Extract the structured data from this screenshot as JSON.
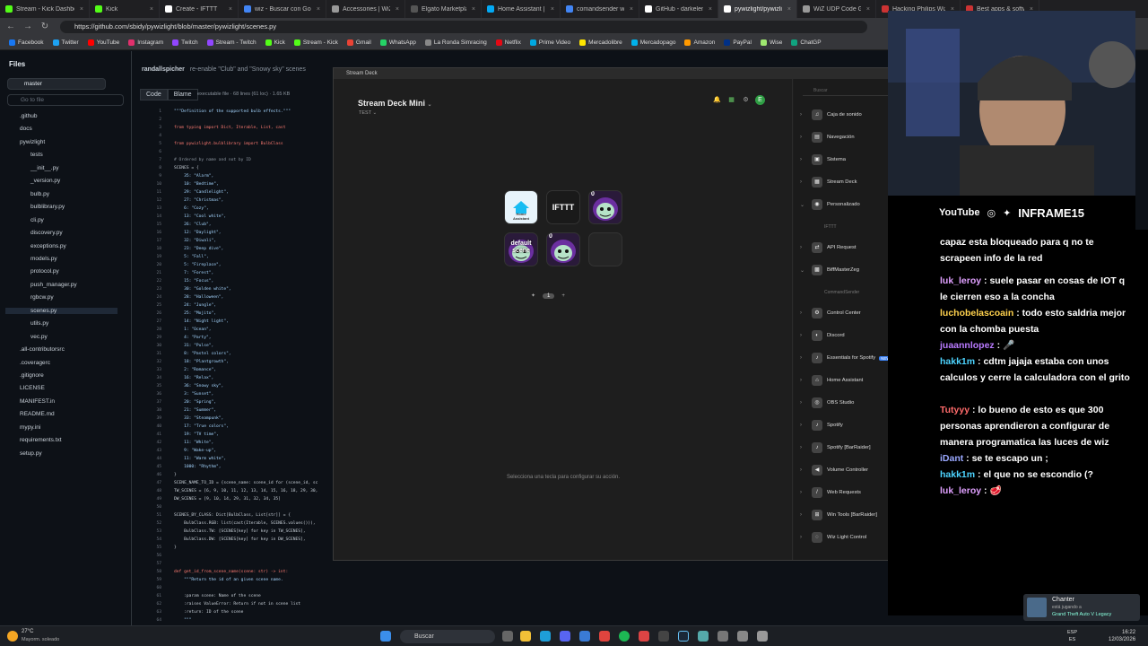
{
  "browser": {
    "tabs": [
      {
        "label": "Stream - Kick Dashbo",
        "color": "#53fc18"
      },
      {
        "label": "Kick",
        "color": "#53fc18"
      },
      {
        "label": "Create - IFTTT",
        "color": "#ffffff"
      },
      {
        "label": "wiz - Buscar con Goog",
        "color": "#4285f4"
      },
      {
        "label": "Accessories | WiZ AR",
        "color": "#999999"
      },
      {
        "label": "Elgato Marketplace",
        "color": "#555555"
      },
      {
        "label": "Home Assistant | Elga",
        "color": "#03a9f4"
      },
      {
        "label": "comandsender wiz - B",
        "color": "#4285f4"
      },
      {
        "label": "GitHub - darkelement",
        "color": "#ffffff"
      },
      {
        "label": "pywizlight/pywizlight",
        "color": "#ffffff"
      },
      {
        "label": "WiZ UDP Code Genera",
        "color": "#999999"
      },
      {
        "label": "Hacking Philips Wiz lig",
        "color": "#cc3333"
      },
      {
        "label": "Best apps & software",
        "color": "#cc3333"
      }
    ],
    "url": "https://github.com/sbidy/pywizlight/blob/master/pywizlight/scenes.py",
    "bookmarks": [
      {
        "label": "Facebook",
        "color": "#1877f2"
      },
      {
        "label": "Twitter",
        "color": "#1da1f2"
      },
      {
        "label": "YouTube",
        "color": "#ff0000"
      },
      {
        "label": "Instagram",
        "color": "#e1306c"
      },
      {
        "label": "Twitch",
        "color": "#9146ff"
      },
      {
        "label": "Stream - Twitch",
        "color": "#9146ff"
      },
      {
        "label": "Kick",
        "color": "#53fc18"
      },
      {
        "label": "Stream - Kick",
        "color": "#53fc18"
      },
      {
        "label": "Gmail",
        "color": "#ea4335"
      },
      {
        "label": "WhatsApp",
        "color": "#25d366"
      },
      {
        "label": "La Ronda Simracing",
        "color": "#888888"
      },
      {
        "label": "Netflix",
        "color": "#e50914"
      },
      {
        "label": "Prime Video",
        "color": "#00a8e1"
      },
      {
        "label": "Mercadolibre",
        "color": "#ffe600"
      },
      {
        "label": "Mercadopago",
        "color": "#00b1ea"
      },
      {
        "label": "Amazon",
        "color": "#ff9900"
      },
      {
        "label": "PayPal",
        "color": "#003087"
      },
      {
        "label": "Wise",
        "color": "#9fe870"
      },
      {
        "label": "ChatGP",
        "color": "#10a37f"
      }
    ]
  },
  "github": {
    "files_title": "Files",
    "branch": "master",
    "goto_placeholder": "Go to file",
    "tree": [
      {
        "label": ".github",
        "depth": 1
      },
      {
        "label": "docs",
        "depth": 1
      },
      {
        "label": "pywizlight",
        "depth": 1
      },
      {
        "label": "tests",
        "depth": 2
      },
      {
        "label": "__init__.py",
        "depth": 2
      },
      {
        "label": "_version.py",
        "depth": 2
      },
      {
        "label": "bulb.py",
        "depth": 2
      },
      {
        "label": "bulblibrary.py",
        "depth": 2
      },
      {
        "label": "cli.py",
        "depth": 2
      },
      {
        "label": "discovery.py",
        "depth": 2
      },
      {
        "label": "exceptions.py",
        "depth": 2
      },
      {
        "label": "models.py",
        "depth": 2
      },
      {
        "label": "protocol.py",
        "depth": 2
      },
      {
        "label": "push_manager.py",
        "depth": 2
      },
      {
        "label": "rgbcw.py",
        "depth": 2
      },
      {
        "label": "scenes.py",
        "depth": 2,
        "selected": true
      },
      {
        "label": "utils.py",
        "depth": 2
      },
      {
        "label": "vec.py",
        "depth": 2
      },
      {
        "label": ".all-contributorsrc",
        "depth": 1
      },
      {
        "label": ".coveragerc",
        "depth": 1
      },
      {
        "label": ".gitignore",
        "depth": 1
      },
      {
        "label": "LICENSE",
        "depth": 1
      },
      {
        "label": "MANIFEST.in",
        "depth": 1
      },
      {
        "label": "README.md",
        "depth": 1
      },
      {
        "label": "mypy.ini",
        "depth": 1
      },
      {
        "label": "requirements.txt",
        "depth": 1
      },
      {
        "label": "setup.py",
        "depth": 1
      }
    ],
    "commit_user": "randallspicher",
    "commit_msg": "re-enable \"Club\" and \"Snowy sky\" scenes",
    "code_tab": "Code",
    "blame_tab": "Blame",
    "file_info": "executable file · 68 lines (61 loc) · 1.65 KB",
    "code": [
      {
        "n": "1",
        "t": "\"\"\"Definition of the supported bulb effects.\"\"\""
      },
      {
        "n": "2",
        "t": ""
      },
      {
        "n": "3",
        "t": "from typing import Dict, Iterable, List, cast"
      },
      {
        "n": "4",
        "t": ""
      },
      {
        "n": "5",
        "t": "from pywizlight.bulblibrary import BulbClass"
      },
      {
        "n": "6",
        "t": ""
      },
      {
        "n": "7",
        "t": "# Ordered by name and not by ID"
      },
      {
        "n": "8",
        "t": "SCENES = {"
      },
      {
        "n": "9",
        "t": "    35: \"Alarm\","
      },
      {
        "n": "10",
        "t": "    10: \"Bedtime\","
      },
      {
        "n": "11",
        "t": "    29: \"Candlelight\","
      },
      {
        "n": "12",
        "t": "    27: \"Christmas\","
      },
      {
        "n": "13",
        "t": "    6: \"Cozy\","
      },
      {
        "n": "14",
        "t": "    13: \"Cool white\","
      },
      {
        "n": "15",
        "t": "    26: \"Club\","
      },
      {
        "n": "16",
        "t": "    12: \"Daylight\","
      },
      {
        "n": "17",
        "t": "    32: \"Diwali\","
      },
      {
        "n": "18",
        "t": "    23: \"Deep dive\","
      },
      {
        "n": "19",
        "t": "    5: \"Fall\","
      },
      {
        "n": "20",
        "t": "    5: \"Fireplace\","
      },
      {
        "n": "21",
        "t": "    7: \"Forest\","
      },
      {
        "n": "22",
        "t": "    15: \"Focus\","
      },
      {
        "n": "23",
        "t": "    30: \"Golden white\","
      },
      {
        "n": "24",
        "t": "    28: \"Halloween\","
      },
      {
        "n": "25",
        "t": "    24: \"Jungle\","
      },
      {
        "n": "26",
        "t": "    25: \"Mojito\","
      },
      {
        "n": "27",
        "t": "    14: \"Night light\","
      },
      {
        "n": "28",
        "t": "    1: \"Ocean\","
      },
      {
        "n": "29",
        "t": "    4: \"Party\","
      },
      {
        "n": "30",
        "t": "    31: \"Pulse\","
      },
      {
        "n": "31",
        "t": "    8: \"Pastel colors\","
      },
      {
        "n": "32",
        "t": "    18: \"Plantgrowth\","
      },
      {
        "n": "33",
        "t": "    2: \"Romance\","
      },
      {
        "n": "34",
        "t": "    16: \"Relax\","
      },
      {
        "n": "35",
        "t": "    36: \"Snowy sky\","
      },
      {
        "n": "36",
        "t": "    3: \"Sunset\","
      },
      {
        "n": "37",
        "t": "    20: \"Spring\","
      },
      {
        "n": "38",
        "t": "    21: \"Summer\","
      },
      {
        "n": "39",
        "t": "    33: \"Steampunk\","
      },
      {
        "n": "40",
        "t": "    17: \"True colors\","
      },
      {
        "n": "41",
        "t": "    19: \"TV time\","
      },
      {
        "n": "42",
        "t": "    11: \"White\","
      },
      {
        "n": "43",
        "t": "    9: \"Wake-up\","
      },
      {
        "n": "44",
        "t": "    11: \"Warm white\","
      },
      {
        "n": "45",
        "t": "    1000: \"Rhythm\","
      },
      {
        "n": "46",
        "t": "}"
      },
      {
        "n": "47",
        "t": "SCENE_NAME_TO_ID = {scene_name: scene_id for (scene_id, sc"
      },
      {
        "n": "48",
        "t": "TW_SCENES = [6, 9, 10, 11, 12, 13, 14, 15, 16, 18, 29, 30,"
      },
      {
        "n": "49",
        "t": "DW_SCENES = [9, 10, 14, 29, 31, 32, 34, 35]"
      },
      {
        "n": "50",
        "t": ""
      },
      {
        "n": "51",
        "t": "SCENES_BY_CLASS: Dict[BulbClass, List[str]] = {"
      },
      {
        "n": "52",
        "t": "    BulbClass.RGB: list(cast(Iterable, SCENES.values())),"
      },
      {
        "n": "53",
        "t": "    BulbClass.TW: [SCENES[key] for key in TW_SCENES],"
      },
      {
        "n": "54",
        "t": "    BulbClass.DW: [SCENES[key] for key in DW_SCENES],"
      },
      {
        "n": "55",
        "t": "}"
      },
      {
        "n": "56",
        "t": ""
      },
      {
        "n": "57",
        "t": ""
      },
      {
        "n": "58",
        "t": "def get_id_from_scene_name(scene: str) -> int:"
      },
      {
        "n": "59",
        "t": "    \"\"\"Return the id of an given scene name."
      },
      {
        "n": "60",
        "t": ""
      },
      {
        "n": "61",
        "t": "    :param scene: Name of the scene"
      },
      {
        "n": "62",
        "t": "    :raises ValueError: Return if not in scene list"
      },
      {
        "n": "63",
        "t": "    :return: ID of the scene"
      },
      {
        "n": "64",
        "t": "    \"\"\""
      }
    ]
  },
  "streamdeck": {
    "window_title": "Stream Deck",
    "device": "Stream Deck Mini",
    "profile": "TEST",
    "keys": [
      {
        "label": "Home Assistant",
        "style": "ha"
      },
      {
        "label": "IFTTT",
        "style": "ifttt"
      },
      {
        "label": "0",
        "style": "char"
      },
      {
        "label": "default scene",
        "style": "char2"
      },
      {
        "label": "0",
        "style": "char"
      },
      {
        "label": "",
        "style": "empty"
      }
    ],
    "page": "1",
    "hint": "Selecciona una tecla para configurar su acción.",
    "search_placeholder": "Buscar",
    "categories": [
      {
        "label": "Caja de sonido",
        "icon": "♫"
      },
      {
        "label": "Navegación",
        "icon": "▤"
      },
      {
        "label": "Sistema",
        "icon": "▣"
      },
      {
        "label": "Stream Deck",
        "icon": "▦"
      },
      {
        "label": "Personalizado",
        "icon": "◉",
        "open": true
      },
      {
        "label": "IFTTT",
        "sub": true
      },
      {
        "label": "API Request",
        "icon": "⇄"
      },
      {
        "label": "BiffMasterZeg",
        "icon": "▩",
        "open": true
      },
      {
        "label": "CommandSender",
        "sub": true
      },
      {
        "label": "Control Center",
        "icon": "⚙"
      },
      {
        "label": "Discord",
        "icon": "◐"
      },
      {
        "label": "Essentials for Spotify",
        "icon": "♪",
        "badge": "NEW"
      },
      {
        "label": "Home Assistant",
        "icon": "⌂"
      },
      {
        "label": "OBS Studio",
        "icon": "◎"
      },
      {
        "label": "Spotify",
        "icon": "♪"
      },
      {
        "label": "Spotify [BarRaider]",
        "icon": "♪"
      },
      {
        "label": "Volume Controller",
        "icon": "◀"
      },
      {
        "label": "Web Requests",
        "icon": "/"
      },
      {
        "label": "Win Tools [BarRaider]",
        "icon": "⊞"
      },
      {
        "label": "Wiz Light Control",
        "icon": "◌"
      }
    ]
  },
  "overlay": {
    "brand": "INFRAME15",
    "youtube": "YouTube",
    "chat": [
      {
        "user": "",
        "text": "capaz esta bloqueado para q no te scrapeen info de la red",
        "color": "#ffffff"
      },
      {
        "user": "luk_leroy",
        "text": " : suele pasar en cosas de IOT q le cierren eso a la concha",
        "color": "#e0a0ff"
      },
      {
        "user": "luchobelascoain",
        "text": " : todo esto saldria mejor con la chomba puesta",
        "color": "#ffd24d"
      },
      {
        "user": "juaannlopez",
        "text": " : 🎤",
        "color": "#b97aff"
      },
      {
        "user": "hakk1m",
        "text": " : cdtm jajaja estaba con unos calculos y cerre la calculadora con el grito",
        "color": "#4dd4ff"
      },
      {
        "user": "Tutyyy",
        "text": " : lo bueno de esto es que 300 personas aprendieron a configurar de manera programatica las luces de wiz",
        "color": "#ff6b6b"
      },
      {
        "user": "iDant",
        "text": " : se te escapo un ;",
        "color": "#9aa8ff"
      },
      {
        "user": "hakk1m",
        "text": " : el que no se escondio (?",
        "color": "#4dd4ff"
      },
      {
        "user": "luk_leroy",
        "text": " : 🥩",
        "color": "#e0a0ff"
      }
    ],
    "notify_title": "Chanter",
    "notify_sub": "está jugando a",
    "notify_game": "Grand Theft Auto V Legacy"
  },
  "taskbar": {
    "weather_temp": "27°C",
    "weather_desc": "Mayorm. soleado",
    "search_label": "Buscar",
    "lang": "ESP",
    "lang2": "ES",
    "time": "16:22",
    "date": "12/03/2026"
  }
}
